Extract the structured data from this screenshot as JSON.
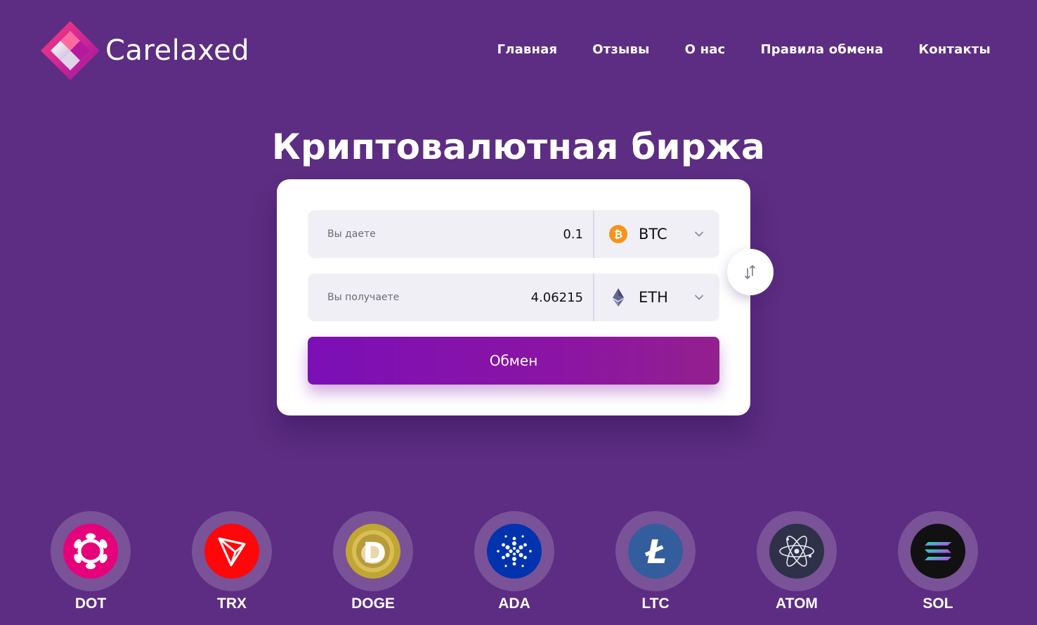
{
  "brand": {
    "name": "Carelaxed"
  },
  "nav": {
    "items": [
      {
        "label": "Главная"
      },
      {
        "label": "Отзывы"
      },
      {
        "label": "О нас"
      },
      {
        "label": "Правила обмена"
      },
      {
        "label": "Контакты"
      }
    ]
  },
  "hero": {
    "title": "Криптовалютная биржа"
  },
  "exchange": {
    "give": {
      "label": "Вы даете",
      "value": "0.1",
      "currency": "BTC",
      "icon": "bitcoin-icon"
    },
    "get": {
      "label": "Вы получаете",
      "value": "4.06215",
      "currency": "ETH",
      "icon": "ethereum-icon"
    },
    "submit_label": "Обмен",
    "swap_icon": "swap-arrows-icon"
  },
  "coins": [
    {
      "code": "DOT",
      "icon": "polkadot-icon",
      "color": "#e6007a"
    },
    {
      "code": "TRX",
      "icon": "tron-icon",
      "color": "#ff060a"
    },
    {
      "code": "DOGE",
      "icon": "dogecoin-icon",
      "color": "#c2a633"
    },
    {
      "code": "ADA",
      "icon": "cardano-icon",
      "color": "#0033ad"
    },
    {
      "code": "LTC",
      "icon": "litecoin-icon",
      "color": "#345d9d"
    },
    {
      "code": "ATOM",
      "icon": "cosmos-icon",
      "color": "#2e3148"
    },
    {
      "code": "SOL",
      "icon": "solana-icon",
      "color": "#111111"
    }
  ],
  "colors": {
    "background": "#5c2d82",
    "accent": "#7b0fb6",
    "btc": "#f7931a",
    "eth": "#62688f"
  }
}
